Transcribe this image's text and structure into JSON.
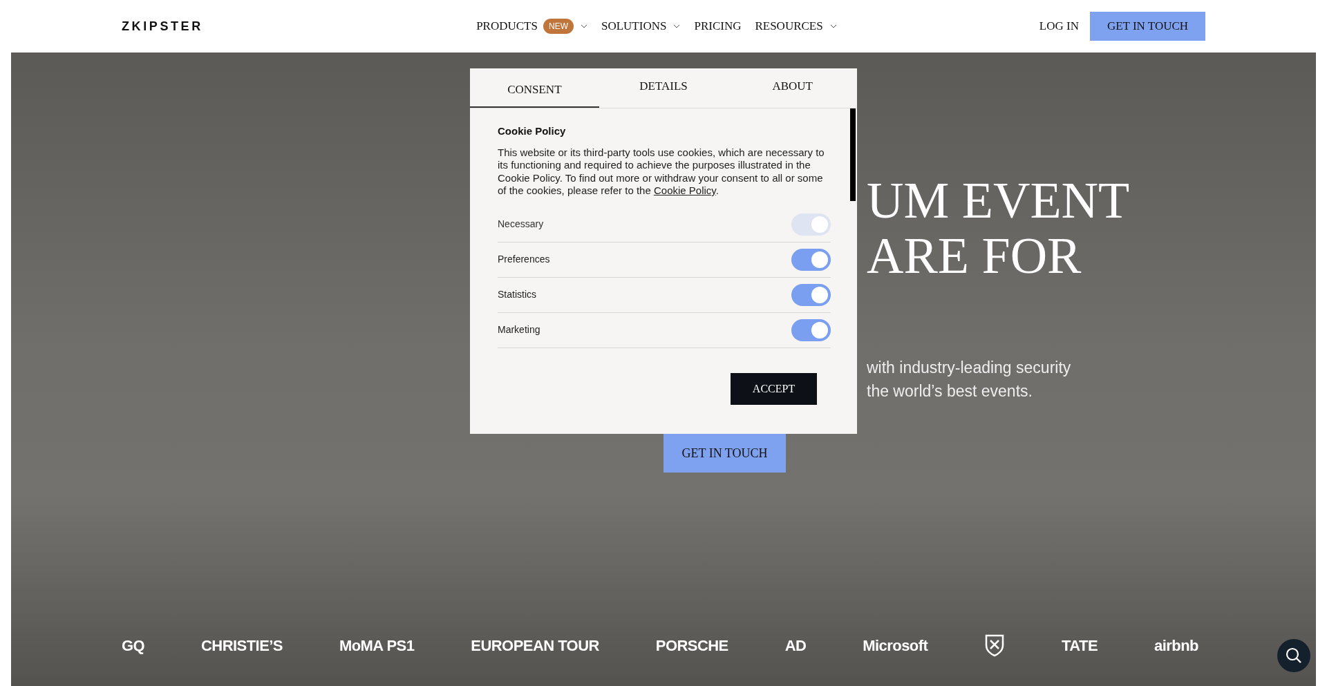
{
  "header": {
    "logo": "ZKIPSTER",
    "nav": [
      {
        "label": "PRODUCTS",
        "badge": "NEW",
        "dropdown": true
      },
      {
        "label": "SOLUTIONS",
        "dropdown": true
      },
      {
        "label": "PRICING",
        "dropdown": false
      },
      {
        "label": "RESOURCES",
        "dropdown": true
      }
    ],
    "login": "LOG IN",
    "cta": "GET IN TOUCH"
  },
  "hero": {
    "headline": [
      "UM EVENT",
      "ARE FOR"
    ],
    "subtitle": [
      "with industry-leading security",
      "the world’s best events."
    ],
    "cta": "GET IN TOUCH"
  },
  "logos": [
    {
      "kind": "text",
      "label": "GQ"
    },
    {
      "kind": "text",
      "label": "CHRISTIE’S"
    },
    {
      "kind": "text",
      "label": "MoMA PS1"
    },
    {
      "kind": "text",
      "label": "EUROPEAN TOUR"
    },
    {
      "kind": "text",
      "label": "PORSCHE"
    },
    {
      "kind": "text",
      "label": "AD"
    },
    {
      "kind": "text",
      "label": "Microsoft"
    },
    {
      "kind": "crest"
    },
    {
      "kind": "text",
      "label": "TATE"
    },
    {
      "kind": "text",
      "label": "airbnb"
    }
  ],
  "cookie_dialog": {
    "tabs": [
      {
        "label": "CONSENT",
        "selected": true
      },
      {
        "label": "DETAILS",
        "selected": false
      },
      {
        "label": "ABOUT",
        "selected": false
      }
    ],
    "title": "Cookie Policy",
    "text": "This website or its third-party tools use cookies, which are necessary to its functioning and required to achieve the purposes illustrated in the Cookie Policy. To find out more or withdraw your consent to all or some of the cookies, please refer to the",
    "link": "Cookie Policy",
    "after_link": ".",
    "categories": [
      {
        "label": "Necessary",
        "checked": true,
        "disabled": true
      },
      {
        "label": "Preferences",
        "checked": true,
        "disabled": false
      },
      {
        "label": "Statistics",
        "checked": true,
        "disabled": false
      },
      {
        "label": "Marketing",
        "checked": true,
        "disabled": false
      }
    ],
    "accept": "ACCEPT"
  }
}
